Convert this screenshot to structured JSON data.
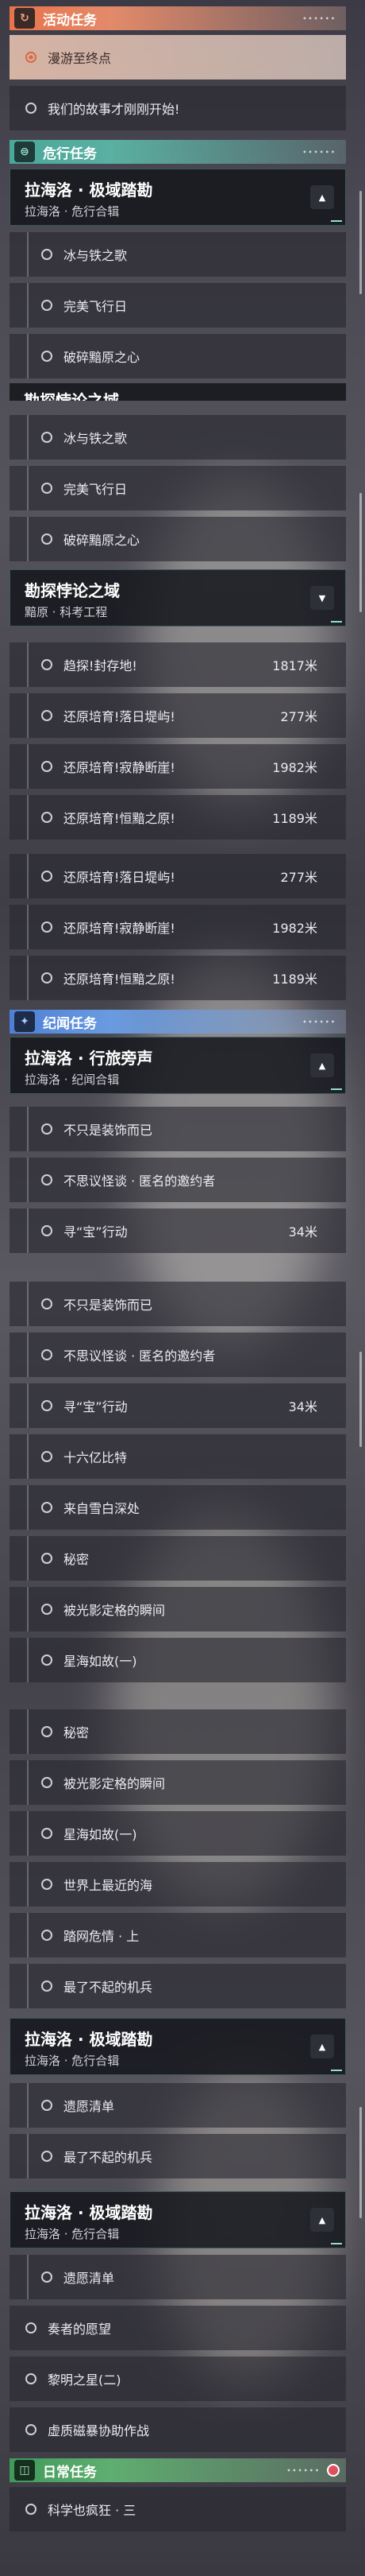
{
  "sections": {
    "activity": {
      "title": "活动任务",
      "icon": "activity-icon",
      "color": "#e8734a"
    },
    "danger": {
      "title": "危行任务",
      "icon": "danger-icon",
      "color": "#4aa89a"
    },
    "legend": {
      "title": "纪闻任务",
      "icon": "legend-icon",
      "color": "#4d7fd6"
    },
    "daily": {
      "title": "日常任务",
      "icon": "daily-icon",
      "color": "#3f9a5a"
    }
  },
  "activity_items": [
    "漫游至终点",
    "我们的故事才刚刚开始!"
  ],
  "q1": {
    "name": "拉海洛 · 极域踏勘",
    "sub": "拉海洛 · 危行合辑"
  },
  "q1_items": [
    "冰与铁之歌",
    "完美飞行日",
    "破碎黯原之心"
  ],
  "partial_title": "勘探悖论之域",
  "q2": {
    "name": "勘探悖论之域",
    "sub": "黯原 · 科考工程"
  },
  "q2_items": [
    {
      "label": "趋探!封存地!",
      "dist": "1817米"
    },
    {
      "label": "还原培育!落日堤屿!",
      "dist": "277米"
    },
    {
      "label": "还原培育!寂静断崖!",
      "dist": "1982米"
    },
    {
      "label": "还原培育!恒黯之原!",
      "dist": "1189米"
    }
  ],
  "q3": {
    "name": "拉海洛 · 行旅旁声",
    "sub": "拉海洛 · 纪闻合辑"
  },
  "q3_items": [
    {
      "label": "不只是装饰而已",
      "dist": ""
    },
    {
      "label": "不思议怪谈 · 匿名的邀约者",
      "dist": ""
    },
    {
      "label": "寻“宝”行动",
      "dist": "34米"
    },
    {
      "label": "十六亿比特",
      "dist": ""
    },
    {
      "label": "来自雪白深处",
      "dist": ""
    },
    {
      "label": "秘密",
      "dist": ""
    },
    {
      "label": "被光影定格的瞬间",
      "dist": ""
    },
    {
      "label": "星海如故(一)",
      "dist": ""
    },
    {
      "label": "世界上最近的海",
      "dist": ""
    },
    {
      "label": "踏网危情 · 上",
      "dist": ""
    },
    {
      "label": "最了不起的机兵",
      "dist": ""
    }
  ],
  "q4": {
    "name": "拉海洛 · 极域踏勘",
    "sub": "拉海洛 · 危行合辑"
  },
  "q4_items": [
    "遗愿清单",
    "最了不起的机兵",
    "奏者的愿望",
    "黎明之星(二)",
    "虚质磁暴协助作战"
  ],
  "daily_items": [
    "科学也疯狂 · 三"
  ],
  "toggle_icon": "▲"
}
